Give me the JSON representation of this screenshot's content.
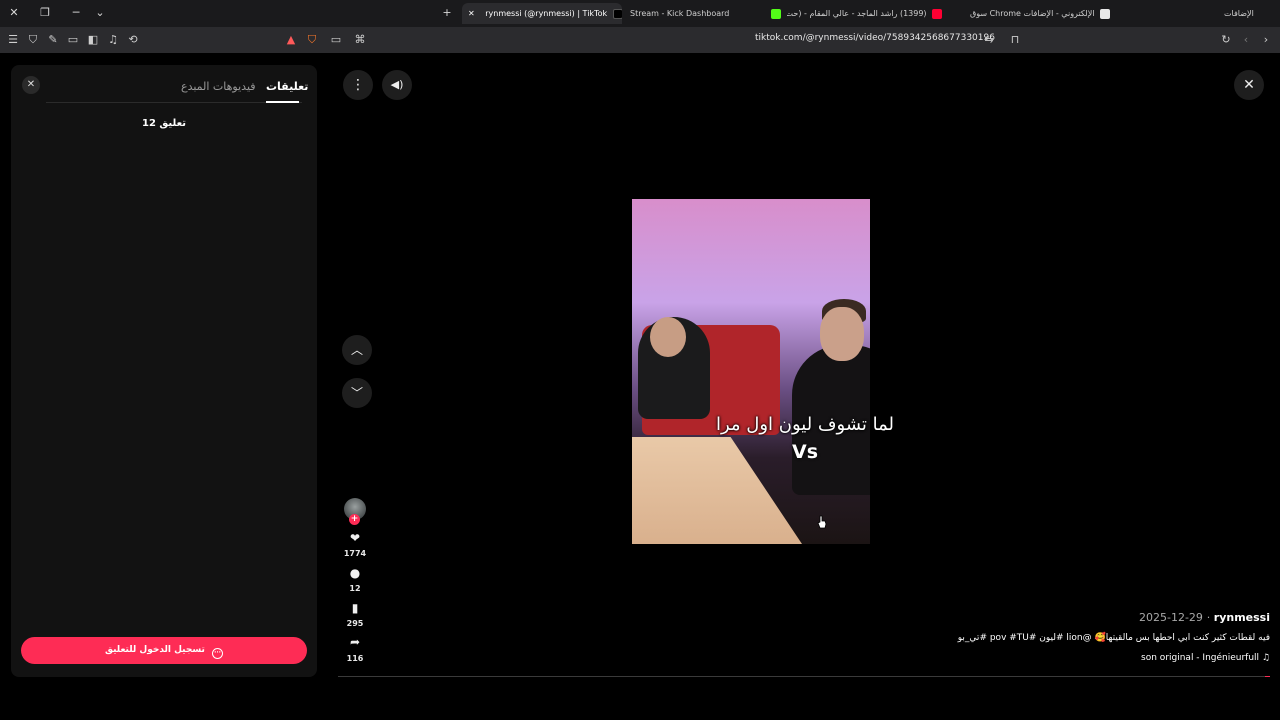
{
  "browser": {
    "tabs": [
      {
        "label": "rynmessi (@rynmessi) | TikTok",
        "active": true
      },
      {
        "label": "Stream - Kick Dashboard",
        "active": false
      },
      {
        "label": "(1399) راشد الماجد - عالي المقام - (حت...",
        "active": false
      },
      {
        "label": "سوق Chrome الإلكتروني - الإضافات",
        "active": false
      }
    ],
    "extensions_label": "الإضافات",
    "url": "tiktok.com/@rynmessi/video/7589342568677330196",
    "colors": {
      "tab_strip": "#1a1a1c",
      "toolbar": "#2b2b2e"
    }
  },
  "comments_panel": {
    "tab_comments": "تعليقات",
    "tab_creator_videos": "فيديوهات المبدع",
    "comment_count": "12 تعليق",
    "login_button": "تسجيل الدخول للتعليق",
    "accent": "#fe2c55"
  },
  "video": {
    "caption_line1": "لما تشوف ليون اول مرا",
    "caption_line2": "Vs"
  },
  "actions": {
    "likes": "1774",
    "comments": "12",
    "saves": "295",
    "shares": "116"
  },
  "post": {
    "username": "rynmessi",
    "date": "2025-12-29",
    "description": "فيه لقطات كثير كنت ابي احطها بس مالقيتها🥰 @lion #ليون #pov #TU #تي_بو",
    "music": "son original - Ingénieurfull",
    "progress_fraction": 0.005
  }
}
